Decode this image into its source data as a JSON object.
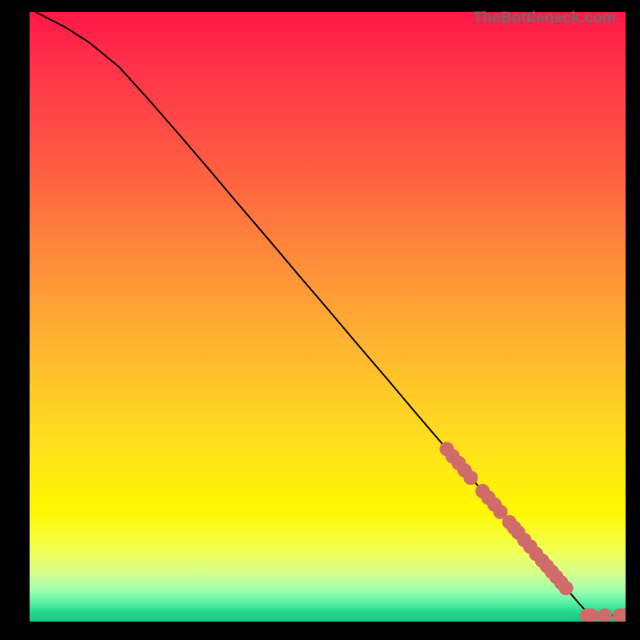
{
  "watermark": "TheBottleneck.com",
  "chart_data": {
    "type": "line",
    "title": "",
    "xlabel": "",
    "ylabel": "",
    "xlim": [
      0,
      100
    ],
    "ylim": [
      0,
      100
    ],
    "grid": false,
    "legend": false,
    "curve": {
      "x": [
        1,
        3,
        6,
        10,
        15,
        20,
        25,
        30,
        35,
        40,
        45,
        50,
        55,
        60,
        65,
        70,
        73,
        76,
        78,
        80,
        82,
        84,
        86,
        87.5,
        89,
        90.5,
        92,
        94,
        96,
        98,
        100
      ],
      "y": [
        100,
        99,
        97.5,
        95,
        91,
        85.6,
        80,
        74.3,
        68.5,
        62.8,
        57,
        51.3,
        45.5,
        39.8,
        34,
        28.3,
        24.8,
        21.4,
        19.2,
        16.9,
        14.6,
        12.3,
        10,
        8.3,
        6.6,
        4.9,
        3.2,
        1.0,
        1.0,
        1.0,
        1.0
      ]
    },
    "markers": {
      "color": "#cf6b69",
      "radius_px": 9,
      "points": [
        {
          "x": 70.0,
          "y": 28.3
        },
        {
          "x": 71.0,
          "y": 27.1
        },
        {
          "x": 72.0,
          "y": 26.0
        },
        {
          "x": 73.0,
          "y": 24.8
        },
        {
          "x": 74.0,
          "y": 23.6
        },
        {
          "x": 76.0,
          "y": 21.4
        },
        {
          "x": 77.0,
          "y": 20.3
        },
        {
          "x": 78.0,
          "y": 19.2
        },
        {
          "x": 79.0,
          "y": 18.0
        },
        {
          "x": 80.5,
          "y": 16.3
        },
        {
          "x": 81.3,
          "y": 15.4
        },
        {
          "x": 82.0,
          "y": 14.6
        },
        {
          "x": 83.0,
          "y": 13.4
        },
        {
          "x": 84.0,
          "y": 12.3
        },
        {
          "x": 85.0,
          "y": 11.1
        },
        {
          "x": 86.0,
          "y": 10.0
        },
        {
          "x": 86.8,
          "y": 9.1
        },
        {
          "x": 87.6,
          "y": 8.2
        },
        {
          "x": 88.4,
          "y": 7.3
        },
        {
          "x": 89.2,
          "y": 6.4
        },
        {
          "x": 90.0,
          "y": 5.5
        },
        {
          "x": 93.5,
          "y": 1.0
        },
        {
          "x": 94.3,
          "y": 1.0
        },
        {
          "x": 96.5,
          "y": 1.0
        },
        {
          "x": 99.0,
          "y": 1.0
        },
        {
          "x": 99.8,
          "y": 1.0
        }
      ]
    }
  }
}
